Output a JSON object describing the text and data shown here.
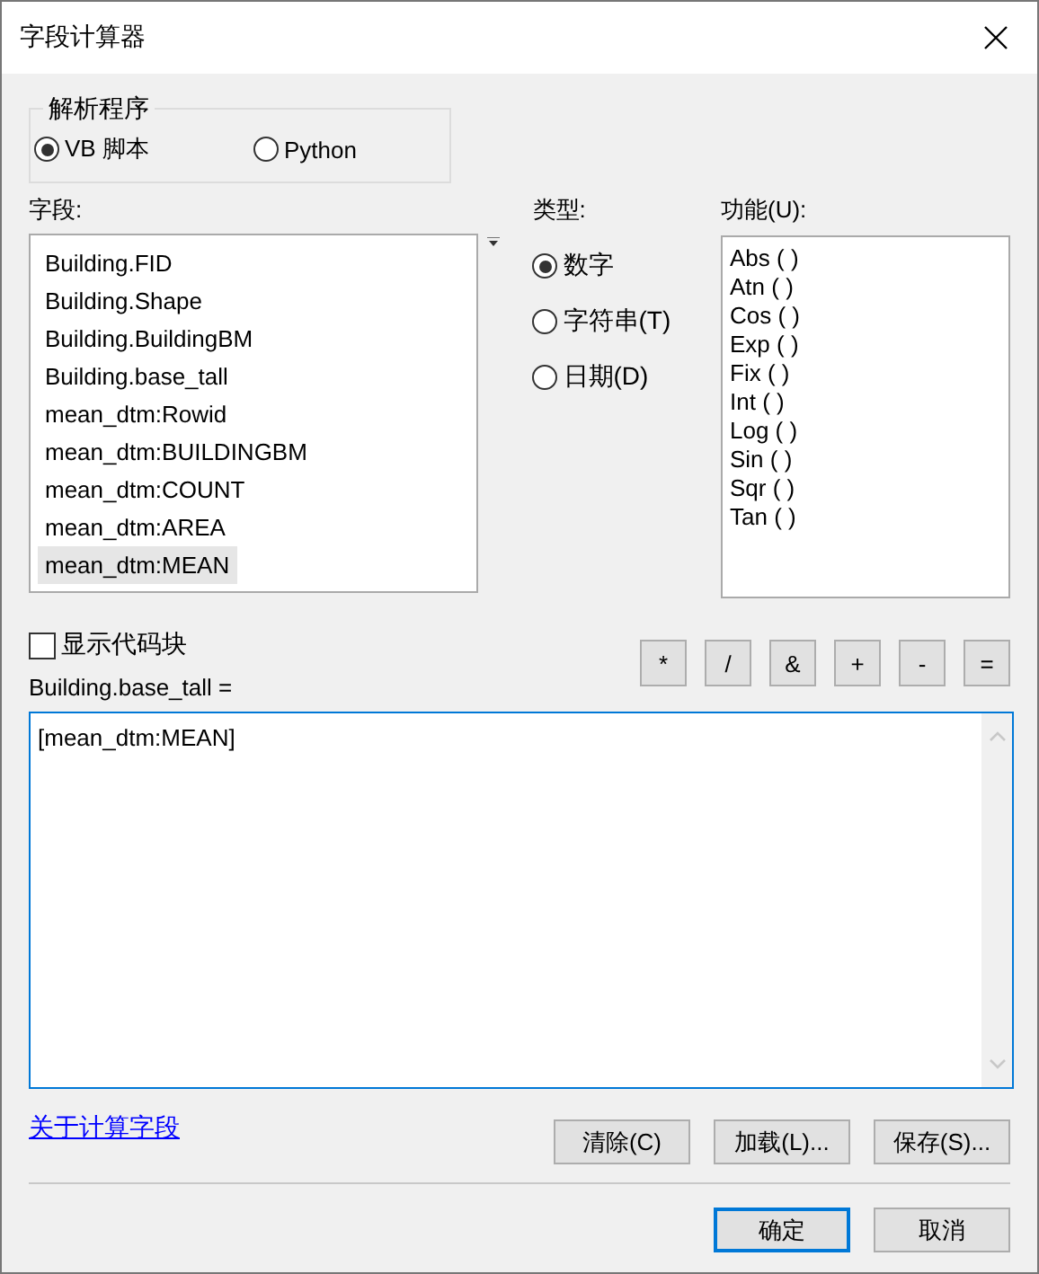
{
  "window": {
    "title": "字段计算器"
  },
  "parser": {
    "legend": "解析程序",
    "options": [
      {
        "label": "VB 脚本",
        "selected": true
      },
      {
        "label": "Python",
        "selected": false
      }
    ]
  },
  "fields": {
    "label": "字段:",
    "items": [
      {
        "label": "Building.FID",
        "selected": false
      },
      {
        "label": "Building.Shape",
        "selected": false
      },
      {
        "label": "Building.BuildingBM",
        "selected": false
      },
      {
        "label": "Building.base_tall",
        "selected": false
      },
      {
        "label": "mean_dtm:Rowid",
        "selected": false
      },
      {
        "label": "mean_dtm:BUILDINGBM",
        "selected": false
      },
      {
        "label": "mean_dtm:COUNT",
        "selected": false
      },
      {
        "label": "mean_dtm:AREA",
        "selected": false
      },
      {
        "label": "mean_dtm:MEAN",
        "selected": true
      }
    ]
  },
  "type": {
    "label": "类型:",
    "options": [
      {
        "label": "数字",
        "selected": true
      },
      {
        "label": "字符串(T)",
        "selected": false
      },
      {
        "label": "日期(D)",
        "selected": false
      }
    ]
  },
  "functions": {
    "label": "功能(U):",
    "items": [
      "Abs ( )",
      "Atn ( )",
      "Cos ( )",
      "Exp ( )",
      "Fix ( )",
      "Int ( )",
      "Log ( )",
      "Sin ( )",
      "Sqr ( )",
      "Tan ( )"
    ]
  },
  "show_codeblock": {
    "label": "显示代码块",
    "checked": false
  },
  "operators": [
    "*",
    "/",
    "&",
    "+",
    "-",
    "="
  ],
  "expression": {
    "label": "Building.base_tall =",
    "value": "[mean_dtm:MEAN]"
  },
  "help_link": "关于计算字段",
  "actions": [
    "清除(C)",
    "加载(L)...",
    "保存(S)..."
  ],
  "footer_buttons": [
    {
      "label": "确定",
      "default": true
    },
    {
      "label": "取消",
      "default": false
    }
  ]
}
